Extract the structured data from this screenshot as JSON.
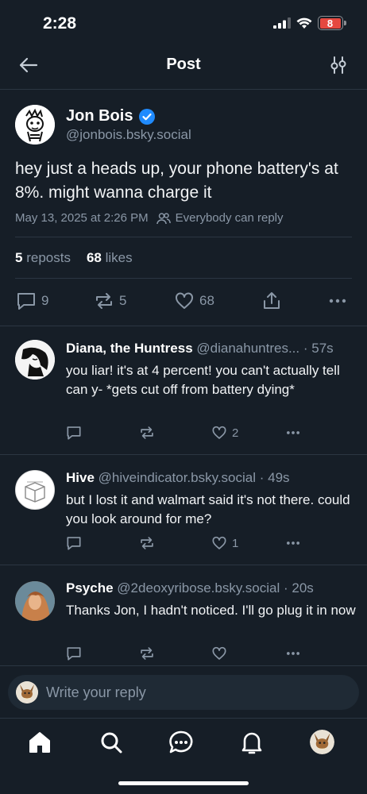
{
  "status_bar": {
    "time": "2:28",
    "battery": "8"
  },
  "header": {
    "title": "Post"
  },
  "post": {
    "author_name": "Jon Bois",
    "author_handle": "@jonbois.bsky.social",
    "text": "hey just a heads up, your phone battery's at 8%. might wanna charge it",
    "timestamp": "May 13, 2025 at 2:26 PM",
    "reply_setting": "Everybody can reply",
    "reposts_count": "5",
    "reposts_label": "reposts",
    "likes_count": "68",
    "likes_label": "likes",
    "actions": {
      "replies": "9",
      "reposts": "5",
      "likes": "68"
    }
  },
  "replies": [
    {
      "name": "Diana, the Huntress",
      "handle": "@dianahuntres...",
      "time": "· 57s",
      "text": "you liar! it's at 4 percent! you can't actually tell can y- *gets cut off from battery dying*",
      "likes": "2"
    },
    {
      "name": "Hive",
      "handle": "@hiveindicator.bsky.social",
      "time": "· 49s",
      "text": "but I lost it and walmart said it's not there. could you look around for me?",
      "likes": "1"
    },
    {
      "name": "Psyche",
      "handle": "@2deoxyribose.bsky.social",
      "time": "· 20s",
      "text": "Thanks Jon, I hadn't noticed. I'll go plug it in now",
      "likes": ""
    }
  ],
  "reply_bar": {
    "placeholder": "Write your reply"
  },
  "tabs": [
    "home-icon",
    "search-icon",
    "chat-icon",
    "bell-icon",
    "profile-avatar"
  ],
  "colors": {
    "background": "#161e27",
    "accent": "#208bfe",
    "muted": "#8a97a6",
    "battery_low": "#e5483f"
  }
}
